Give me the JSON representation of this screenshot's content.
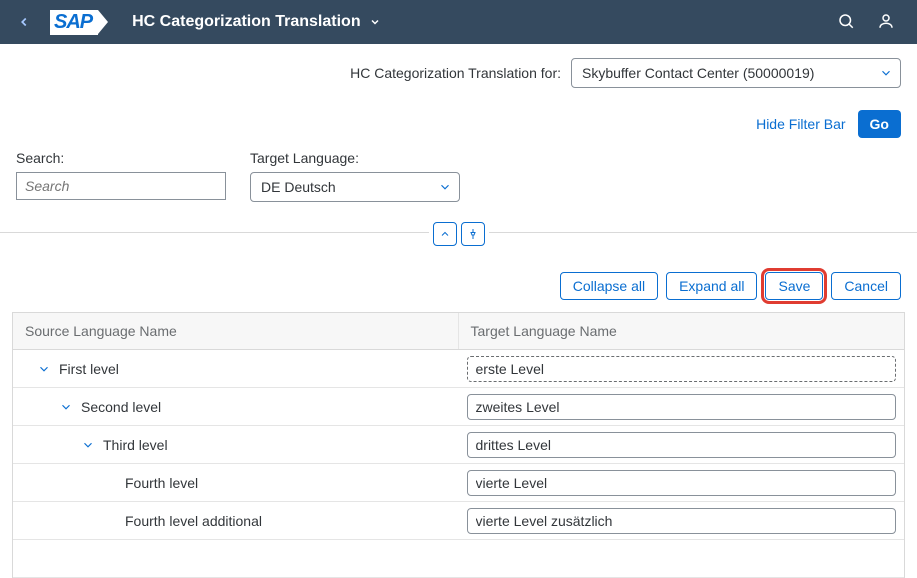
{
  "header": {
    "logo_text": "SAP",
    "app_title": "HC Categorization Translation"
  },
  "context": {
    "label": "HC Categorization Translation for:",
    "value": "Skybuffer Contact Center (50000019)"
  },
  "filter_bar": {
    "hide_label": "Hide Filter Bar",
    "go_label": "Go",
    "search_label": "Search:",
    "search_placeholder": "Search",
    "lang_label": "Target Language:",
    "lang_value": "DE Deutsch"
  },
  "toolbar": {
    "collapse_label": "Collapse all",
    "expand_label": "Expand all",
    "save_label": "Save",
    "cancel_label": "Cancel"
  },
  "table": {
    "col_src": "Source Language Name",
    "col_tgt": "Target Language Name",
    "rows": [
      {
        "src": "First level",
        "tgt": "erste Level"
      },
      {
        "src": "Second level",
        "tgt": "zweites Level"
      },
      {
        "src": "Third level",
        "tgt": "drittes Level"
      },
      {
        "src": "Fourth level",
        "tgt": "vierte Level"
      },
      {
        "src": "Fourth level additional",
        "tgt": "vierte Level zusätzlich"
      }
    ]
  }
}
